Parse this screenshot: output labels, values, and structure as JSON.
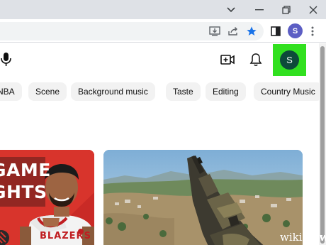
{
  "browser": {
    "profile_initial": "S"
  },
  "youtube": {
    "avatar_initial": "S",
    "chips": [
      "NBA",
      "Scene",
      "Background music",
      "Taste",
      "Editing",
      "Country Music"
    ]
  },
  "thumbnails": [
    {
      "overlay_lines": [
        "GAME",
        "GHTS"
      ],
      "jersey_text": "BLAZERS"
    },
    {}
  ],
  "watermark": {
    "prefix": "wiki",
    "suffix": "How"
  },
  "colors": {
    "highlight": "#31e01f",
    "avatar_bg": "#0d4a3a",
    "star_blue": "#1a73e8",
    "profile_mini": "#5c5ec4"
  }
}
